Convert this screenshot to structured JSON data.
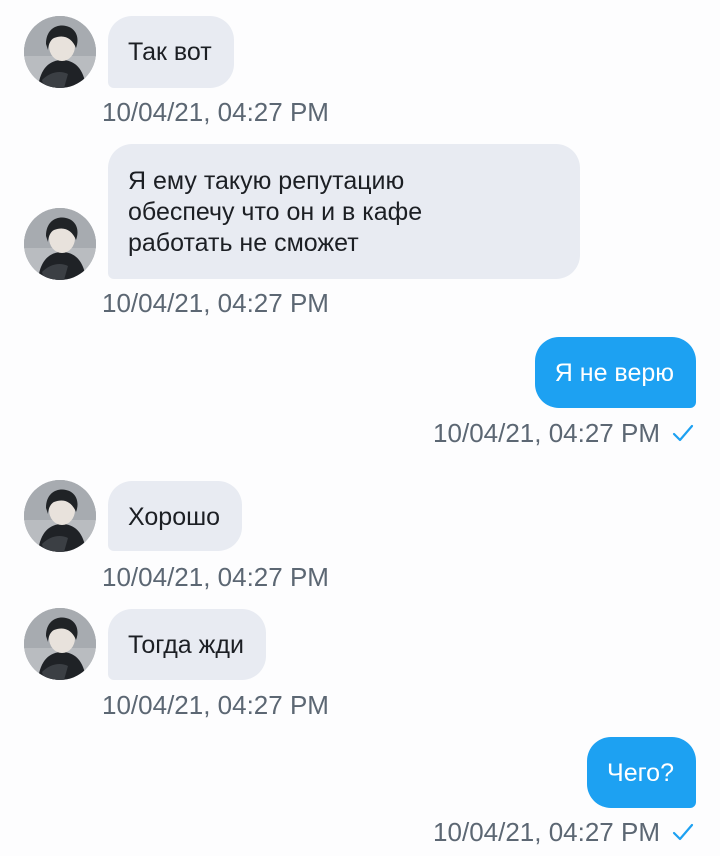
{
  "messages": [
    {
      "direction": "incoming",
      "text": "Так вот",
      "timestamp": "10/04/21, 04:27 PM"
    },
    {
      "direction": "incoming",
      "text": "Я ему такую репутацию обеспечу что он и в кафе работать не сможет",
      "lines": [
        "Я ему такую репутацию",
        "обеспечу что он и в кафе",
        "работать не сможет"
      ],
      "timestamp": "10/04/21, 04:27 PM"
    },
    {
      "direction": "outgoing",
      "text": "Я не верю",
      "timestamp": "10/04/21, 04:27 PM",
      "status_icon": "check-icon"
    },
    {
      "direction": "incoming",
      "text": "Хорошо",
      "timestamp": "10/04/21, 04:27 PM"
    },
    {
      "direction": "incoming",
      "text": "Тогда жди",
      "timestamp": "10/04/21, 04:27 PM"
    },
    {
      "direction": "outgoing",
      "text": "Чего?",
      "timestamp": "10/04/21, 04:27 PM",
      "status_icon": "check-icon"
    }
  ],
  "colors": {
    "incoming_bubble": "#e8ebf2",
    "outgoing_bubble": "#1da1f2",
    "timestamp": "#5c6773",
    "check": "#1da1f2"
  }
}
